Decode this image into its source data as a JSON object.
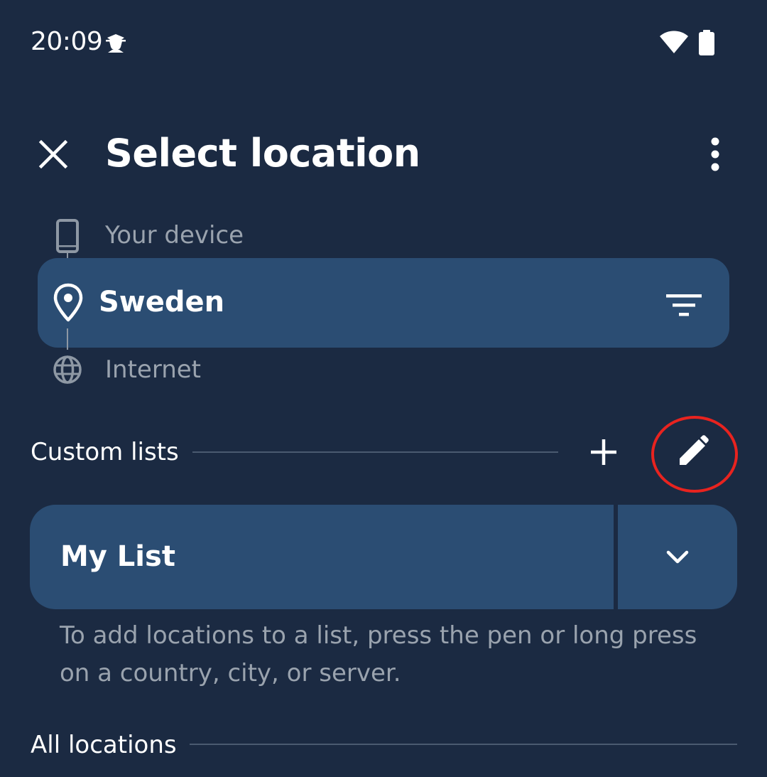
{
  "status_bar": {
    "time": "20:09",
    "app_icon": "spy-icon",
    "wifi_icon": "wifi-icon",
    "battery_icon": "battery-icon"
  },
  "top_bar": {
    "title": "Select location",
    "close_icon": "close-icon",
    "more_icon": "more-vertical-icon"
  },
  "hops": {
    "device": {
      "label": "Your device",
      "icon": "phone-icon"
    },
    "selected": {
      "label": "Sweden",
      "icon": "location-pin-icon",
      "filter_icon": "filter-icon"
    },
    "exit": {
      "label": "Internet",
      "icon": "globe-icon"
    }
  },
  "custom_lists": {
    "title": "Custom lists",
    "add_icon": "plus-icon",
    "edit_icon": "pencil-icon",
    "highlight_color": "#e8231f",
    "lists": [
      {
        "label": "My List",
        "expand_icon": "chevron-down-icon"
      }
    ],
    "hint": "To add locations to a list, press the pen or long press on a country, city, or server."
  },
  "all_locations": {
    "title": "All locations"
  },
  "colors": {
    "background": "#1b2a42",
    "row": "#2b4d73",
    "muted_text": "#9aa3ae"
  }
}
